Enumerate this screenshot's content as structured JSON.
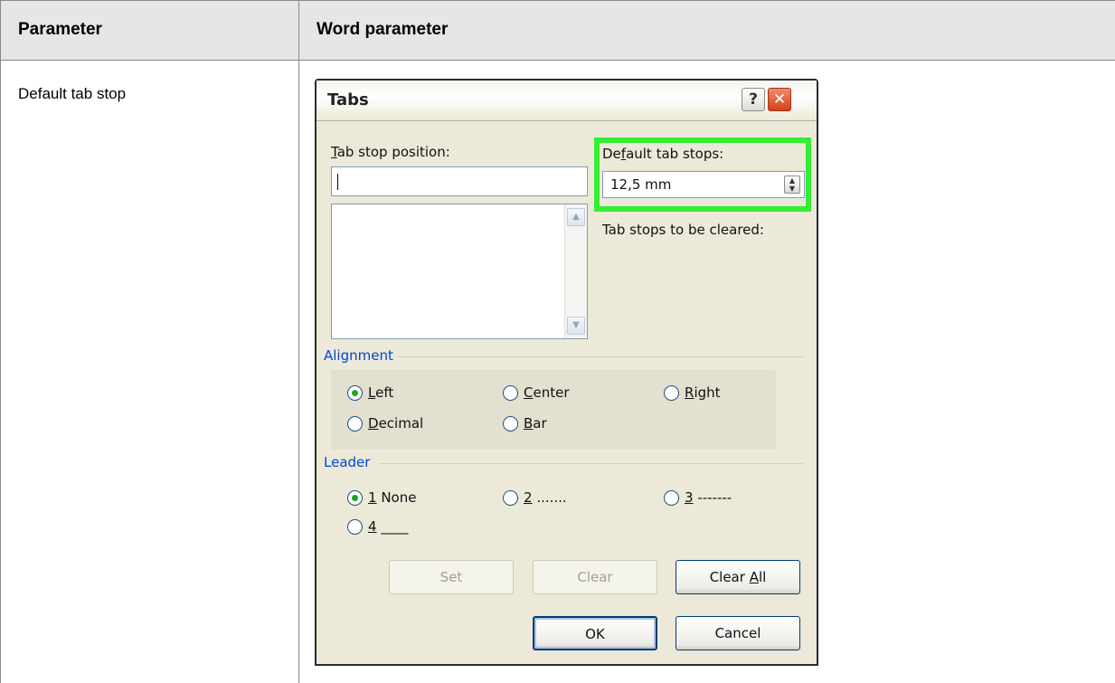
{
  "table": {
    "header": {
      "col1": "Parameter",
      "col2": "Word parameter"
    },
    "row1": {
      "param": "Default tab stop"
    }
  },
  "dialog": {
    "title": "Tabs",
    "help_glyph": "?",
    "close_glyph": "✕",
    "tab_stop_position": {
      "label_pre": "",
      "label_u": "T",
      "label_post": "ab stop position:",
      "value": ""
    },
    "default_tab_stops": {
      "label_pre": "De",
      "label_u": "f",
      "label_post": "ault tab stops:",
      "value": "12,5 mm"
    },
    "tab_stops_cleared_label": "Tab stops to be cleared:",
    "alignment": {
      "title": "Alignment",
      "options": [
        {
          "u": "L",
          "rest": "eft",
          "selected": true
        },
        {
          "u": "C",
          "rest": "enter",
          "selected": false
        },
        {
          "u": "R",
          "rest": "ight",
          "selected": false
        },
        {
          "u": "D",
          "rest": "ecimal",
          "selected": false
        },
        {
          "u": "B",
          "rest": "ar",
          "selected": false
        }
      ]
    },
    "leader": {
      "title": "Leader",
      "options": [
        {
          "u": "1",
          "rest": " None",
          "selected": true
        },
        {
          "u": "2",
          "rest": " .......",
          "selected": false
        },
        {
          "u": "3",
          "rest": " -------",
          "selected": false
        },
        {
          "u": "4",
          "rest": " ____",
          "selected": false
        }
      ]
    },
    "buttons": {
      "set": "Set",
      "clear": "Clear",
      "clear_all_pre": "Clear ",
      "clear_all_u": "A",
      "clear_all_post": "ll",
      "ok": "OK",
      "cancel": "Cancel"
    },
    "highlight_color": "#33ee33",
    "accent_group_title_color": "#0046d5"
  }
}
